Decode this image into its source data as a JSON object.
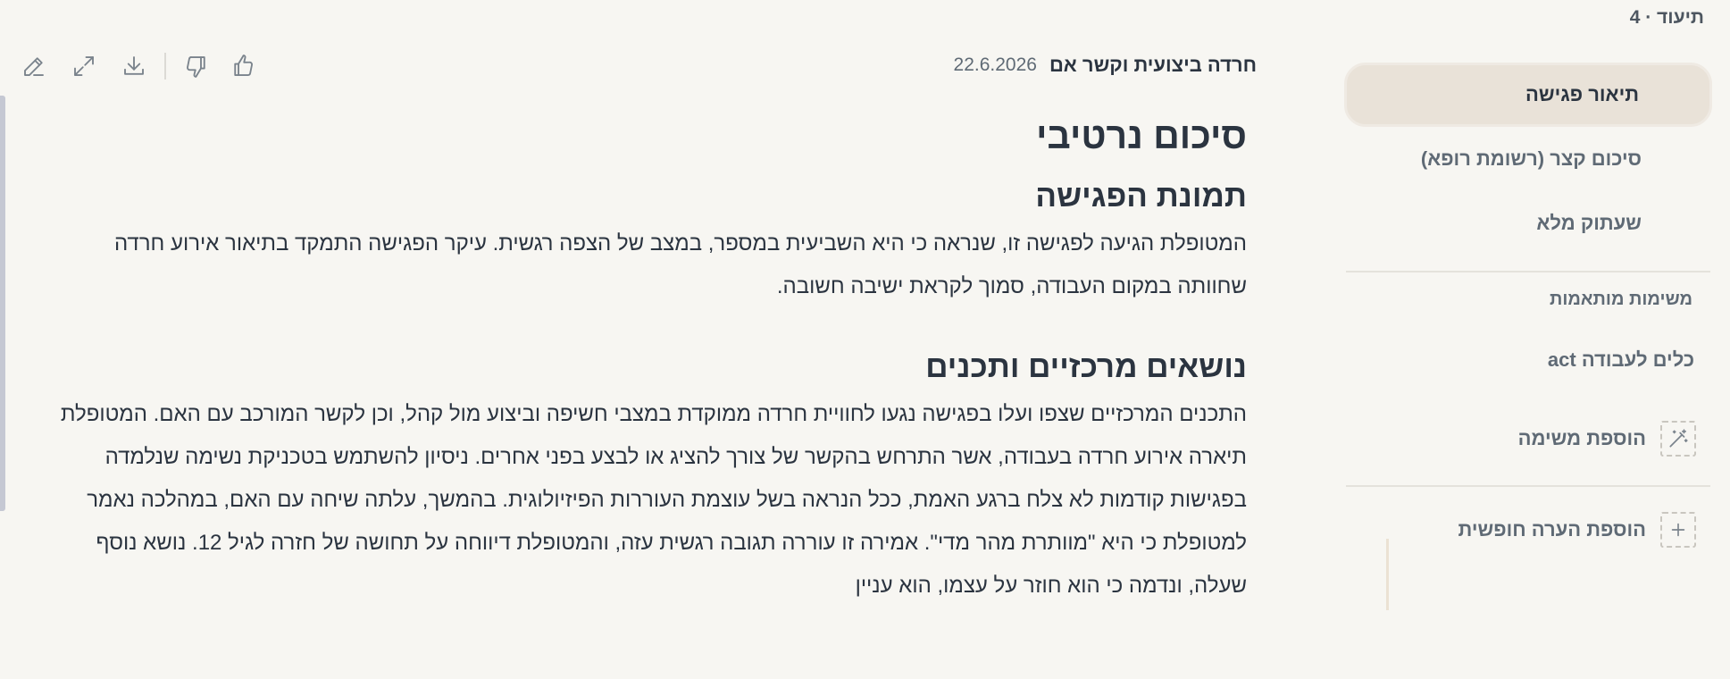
{
  "sidebar": {
    "header": "תיעוד · 4",
    "nav": [
      {
        "label": "תיאור פגישה",
        "active": true
      },
      {
        "label": "סיכום קצר (רשומת רופא)",
        "active": false
      },
      {
        "label": "שעתוק מלא",
        "active": false
      }
    ],
    "tasks_label": "משימות מותאמות",
    "tasks": [
      {
        "label": "כלים לעבודה act"
      }
    ],
    "add_task_label": "הוספת משימה",
    "add_note_label": "הוספת הערה חופשית"
  },
  "document": {
    "title": "חרדה ביצועית וקשר אם",
    "date": "22.6.2026",
    "heading": "סיכום נרטיבי",
    "sections": [
      {
        "title": "תמונת הפגישה",
        "body": "המטופלת הגיעה לפגישה זו, שנראה כי היא השביעית במספר, במצב של הצפה רגשית. עיקר הפגישה התמקד בתיאור אירוע חרדה שחוותה במקום העבודה, סמוך לקראת ישיבה חשובה."
      },
      {
        "title": "נושאים מרכזיים ותכנים",
        "body": "התכנים המרכזיים שצפו ועלו בפגישה נגעו לחוויית חרדה ממוקדת במצבי חשיפה וביצוע מול קהל, וכן לקשר המורכב עם האם. המטופלת תיארה אירוע חרדה בעבודה, אשר התרחש בהקשר של צורך להציג או לבצע בפני אחרים. ניסיון להשתמש בטכניקת נשימה שנלמדה בפגישות קודמות לא צלח ברגע האמת, ככל הנראה בשל עוצמת העוררות הפיזיולוגית. בהמשך, עלתה שיחה עם האם, במהלכה נאמר למטופלת כי היא \"מוותרת מהר מדי\". אמירה זו עוררה תגובה רגשית עזה, והמטופלת דיווחה על תחושה של חזרה לגיל 12. נושא נוסף שעלה, ונדמה כי הוא חוזר על עצמו, הוא עניין"
      }
    ]
  },
  "toolbar": {
    "icons": [
      "edit-icon",
      "expand-icon",
      "download-icon",
      "thumbs-down-icon",
      "thumbs-up-icon"
    ]
  }
}
